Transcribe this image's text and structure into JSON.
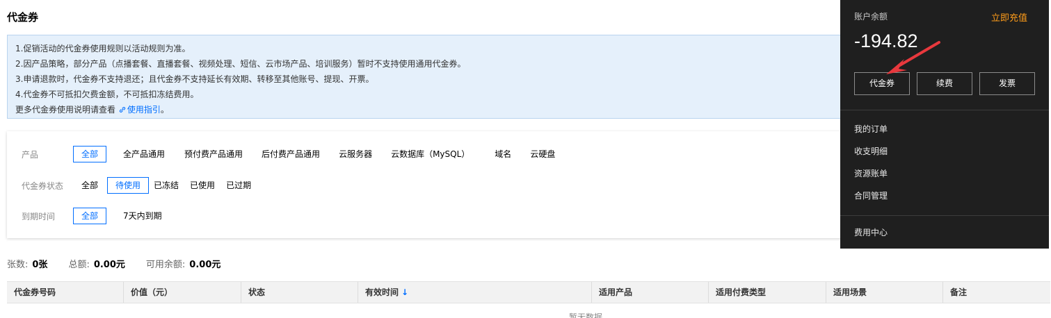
{
  "page": {
    "title": "代金券"
  },
  "notice": {
    "lines": [
      "1.促销活动的代金券使用规则以活动规则为准。",
      "2.因产品策略，部分产品（点播套餐、直播套餐、视频处理、短信、云市场产品、培训服务）暂时不支持使用通用代金券。",
      "3.申请退款时，代金券不支持退还；且代金券不支持延长有效期、转移至其他账号、提现、开票。",
      "4.代金券不可抵扣欠费金额，不可抵扣冻结费用。"
    ],
    "more_prefix": "更多代金券使用说明请查看",
    "link_label": "使用指引",
    "link_suffix": "。"
  },
  "filters": {
    "product": {
      "label": "产品",
      "options": [
        "全部",
        "全产品通用",
        "预付费产品通用",
        "后付费产品通用",
        "云服务器",
        "云数据库（MySQL）",
        "域名",
        "云硬盘"
      ],
      "selected": "全部"
    },
    "status": {
      "label": "代金券状态",
      "options": [
        "全部",
        "待使用",
        "已冻结",
        "已使用",
        "已过期"
      ],
      "selected": "待使用"
    },
    "expiry": {
      "label": "到期时间",
      "options": [
        "全部",
        "7天内到期"
      ],
      "selected": "全部"
    }
  },
  "stats": {
    "count_label": "张数:",
    "count_value": "0张",
    "total_label": "总额:",
    "total_value": "0.00元",
    "available_label": "可用余额:",
    "available_value": "0.00元"
  },
  "table": {
    "columns": [
      "代金券号码",
      "价值（元）",
      "状态",
      "有效时间",
      "适用产品",
      "适用付费类型",
      "适用场景",
      "备注"
    ],
    "sort_icon": "arrow-down",
    "empty_text": "暂无数据"
  },
  "account_dropdown": {
    "balance_label": "账户余额",
    "recharge_label": "立即充值",
    "balance_value": "-194.82",
    "buttons": [
      "代金券",
      "续费",
      "发票"
    ],
    "menu": [
      "我的订单",
      "收支明细",
      "资源账单",
      "合同管理"
    ],
    "footer": "费用中心"
  },
  "colors": {
    "accent": "#006eff",
    "recharge": "#ff9c19",
    "dropdown_bg": "#1f1f1f",
    "notice_bg": "#e5f0fb",
    "annotation_arrow": "#e8383d"
  }
}
